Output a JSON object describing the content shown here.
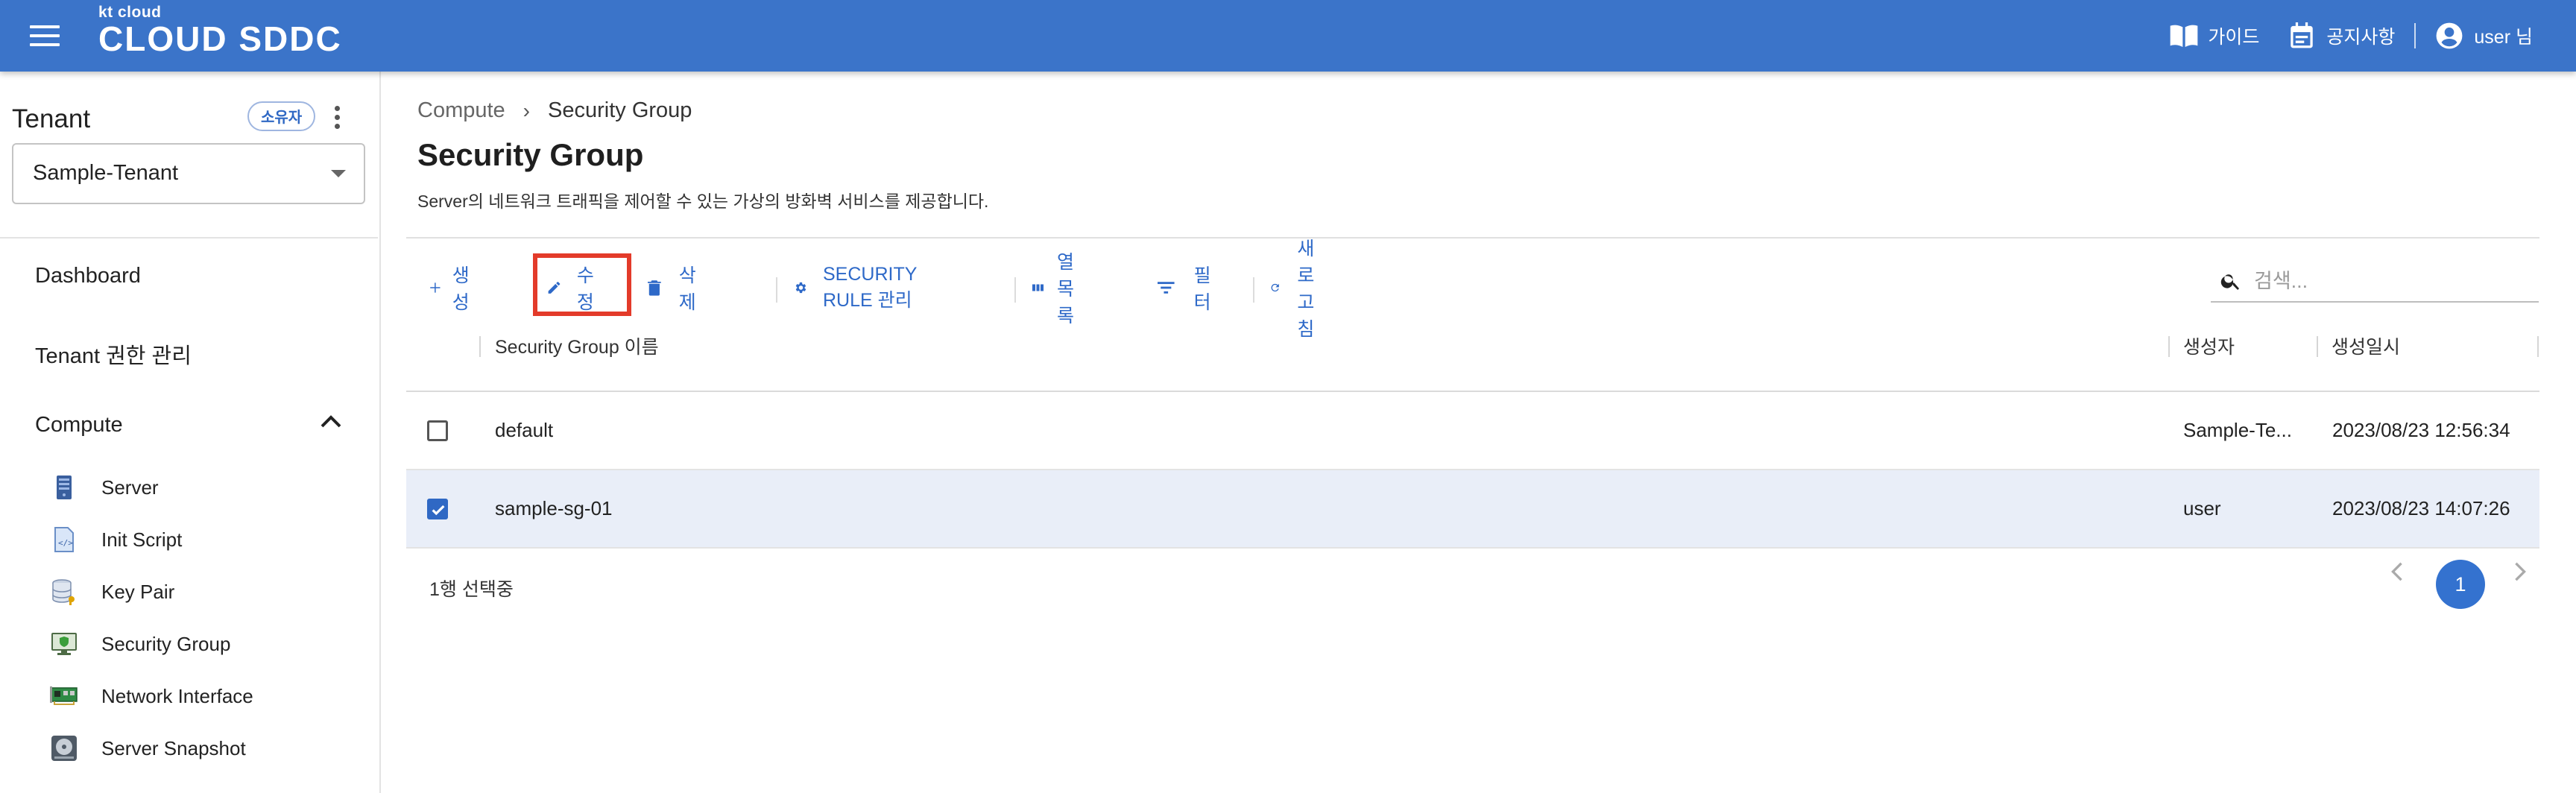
{
  "header": {
    "logo_small": "kt cloud",
    "logo_main": "CLOUD SDDC",
    "guide_label": "가이드",
    "notice_label": "공지사항",
    "user_label": "user 님",
    "bar_color": "#3b74c9"
  },
  "sidebar": {
    "tenant_label": "Tenant",
    "owner_badge": "소유자",
    "tenant_select_value": "Sample-Tenant",
    "menu": {
      "dashboard": "Dashboard",
      "tenant_auth": "Tenant 권한 관리",
      "compute": "Compute"
    },
    "compute_items": [
      {
        "label": "Server",
        "icon": "server-icon"
      },
      {
        "label": "Init Script",
        "icon": "script-file-icon"
      },
      {
        "label": "Key Pair",
        "icon": "database-key-icon"
      },
      {
        "label": "Security Group",
        "icon": "monitor-shield-icon"
      },
      {
        "label": "Network Interface",
        "icon": "network-card-icon"
      },
      {
        "label": "Server Snapshot",
        "icon": "disk-snapshot-icon"
      }
    ]
  },
  "main": {
    "breadcrumb": {
      "parent": "Compute",
      "current": "Security Group"
    },
    "title": "Security Group",
    "description": "Server의 네트워크 트래픽을 제어할 수 있는 가상의 방화벽 서비스를 제공합니다.",
    "toolbar": {
      "create": "생성",
      "edit": "수정",
      "delete": "삭제",
      "rule_manage": "SECURITY RULE 관리",
      "columns": "열 목록",
      "filter": "필터",
      "refresh": "새로고침"
    },
    "search_placeholder": "검색...",
    "table": {
      "columns": [
        "Security Group 이름",
        "생성자",
        "생성일시"
      ],
      "rows": [
        {
          "name": "default",
          "creator": "Sample-Te...",
          "created_at": "2023/08/23 12:56:34",
          "selected": false
        },
        {
          "name": "sample-sg-01",
          "creator": "user",
          "created_at": "2023/08/23 14:07:26",
          "selected": true
        }
      ]
    },
    "selection_status": "1행 선택중",
    "pagination": {
      "current_page": "1"
    },
    "accent_color": "#2e69c8",
    "highlight_color": "#e33b2a"
  }
}
